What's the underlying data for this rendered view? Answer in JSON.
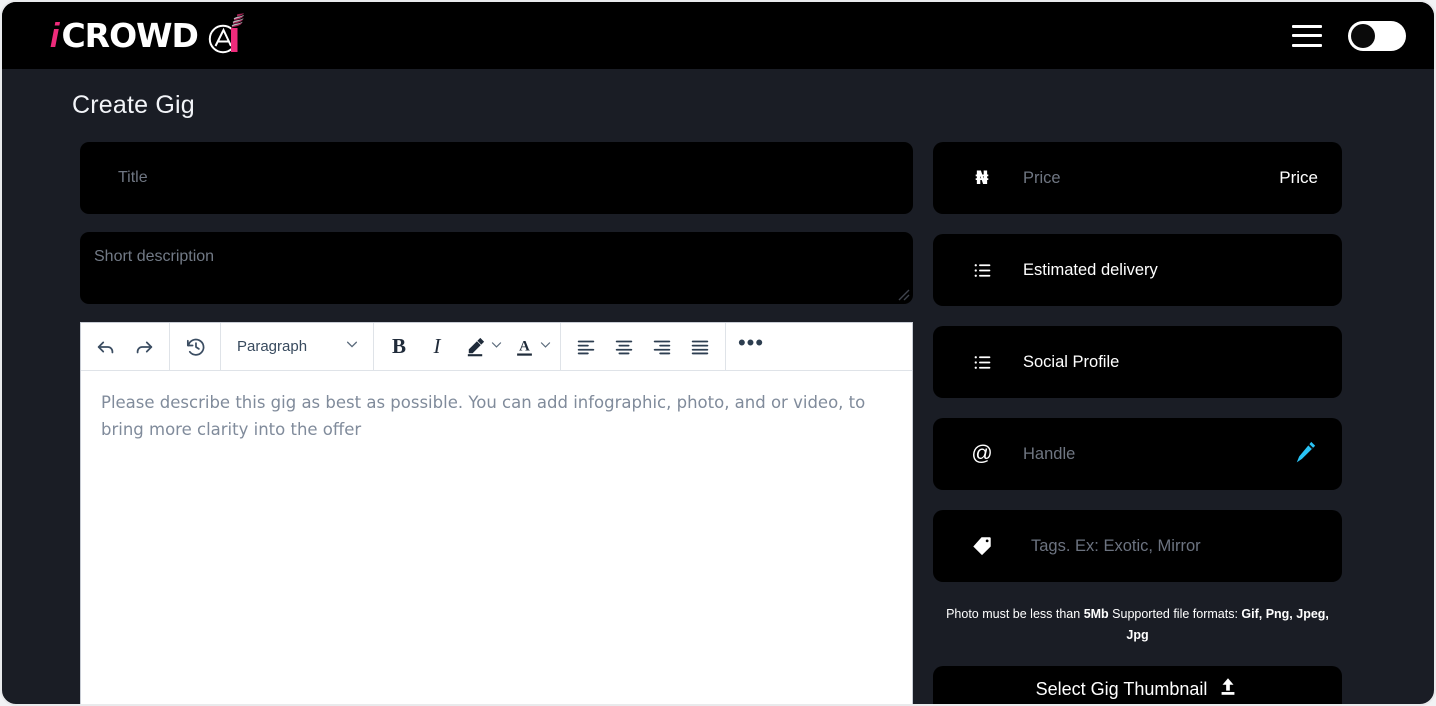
{
  "header": {
    "logo": {
      "text_i": "i",
      "text_main": "CROWD",
      "mark_name": "icrowd-a-mark",
      "accent_pink": "#ee2b7b"
    },
    "menu_icon": "hamburger-icon",
    "toggle": {
      "name": "theme-toggle",
      "state": "off"
    }
  },
  "page": {
    "title": "Create Gig",
    "background": "#1a1d25",
    "field_background": "#000000"
  },
  "form": {
    "title_field": {
      "placeholder": "Title",
      "value": ""
    },
    "short_description_field": {
      "placeholder": "Short description",
      "value": ""
    },
    "editor": {
      "placeholder": "Please describe this gig as best as possible. You can add infographic, photo, and or video, to bring more clarity into the offer",
      "content": "",
      "toolbar": {
        "undo": "undo-icon",
        "redo": "redo-icon",
        "history": "revision-history-icon",
        "block_format": "Paragraph",
        "bold_label": "B",
        "italic_label": "I",
        "highlight": "highlighter-icon",
        "font_color_label": "A",
        "align_left": "align-left-icon",
        "align_center": "align-center-icon",
        "align_right": "align-right-icon",
        "align_justify": "align-justify-icon",
        "more_label": "•••"
      }
    }
  },
  "sidebar": {
    "price": {
      "currency_symbol": "₦",
      "placeholder": "Price",
      "value": "",
      "label": "Price"
    },
    "estimated_delivery": {
      "icon": "list-icon",
      "label": "Estimated delivery"
    },
    "social_profile": {
      "icon": "list-icon",
      "label": "Social Profile"
    },
    "handle": {
      "icon": "at-icon",
      "placeholder": "Handle",
      "value": "",
      "action_icon": "pen-icon",
      "action_color": "#29c3f5"
    },
    "tags": {
      "icon": "tag-icon",
      "placeholder": "Tags. Ex: Exotic, Mirror",
      "value": ""
    },
    "photo_note": {
      "part1": "Photo must be less than ",
      "size_limit": "5Mb",
      "part2": " Supported file formats: ",
      "formats": "Gif, Png, Jpeg, Jpg"
    },
    "thumbnail_button": {
      "label": "Select Gig Thumbnail",
      "icon": "upload-icon"
    }
  }
}
